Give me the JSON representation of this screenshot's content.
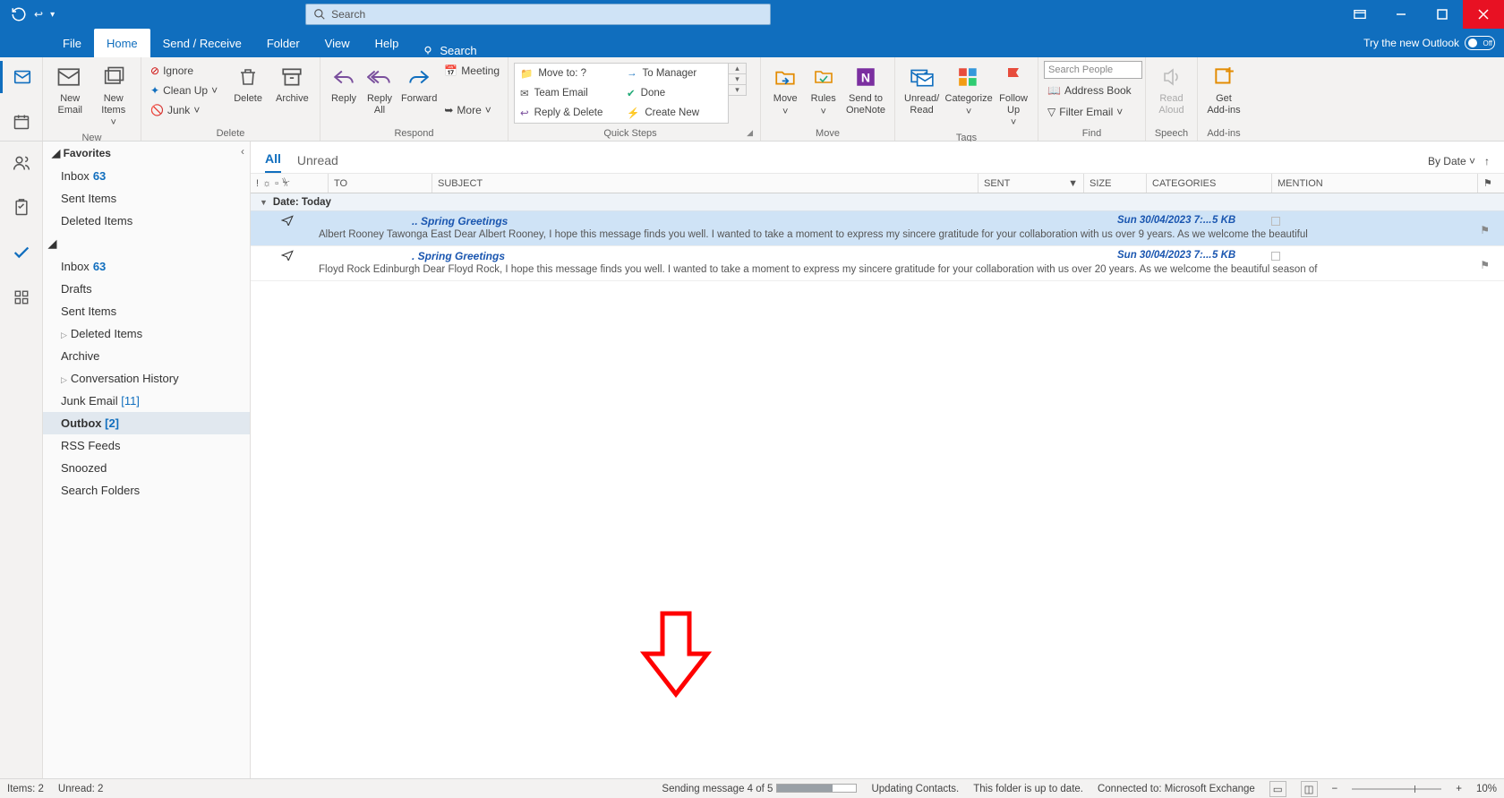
{
  "search_placeholder": "Search",
  "tabs": {
    "file": "File",
    "home": "Home",
    "sendreceive": "Send / Receive",
    "folder": "Folder",
    "view": "View",
    "help": "Help",
    "tellme": "Search"
  },
  "try_new": "Try the new Outlook",
  "toggle_off": "Off",
  "ribbon": {
    "new": {
      "email": "New Email",
      "items": "New Items",
      "label": "New"
    },
    "delete": {
      "ignore": "Ignore",
      "cleanup": "Clean Up",
      "junk": "Junk",
      "delete": "Delete",
      "archive": "Archive",
      "label": "Delete"
    },
    "respond": {
      "reply": "Reply",
      "replyall": "Reply All",
      "forward": "Forward",
      "meeting": "Meeting",
      "more": "More",
      "label": "Respond"
    },
    "quicksteps": {
      "moveto": "Move to: ?",
      "tomanager": "To Manager",
      "teamemail": "Team Email",
      "done": "Done",
      "replydelete": "Reply & Delete",
      "createnew": "Create New",
      "label": "Quick Steps"
    },
    "move": {
      "move": "Move",
      "rules": "Rules",
      "onenote": "Send to OneNote",
      "label": "Move"
    },
    "tags": {
      "unread": "Unread/ Read",
      "categorize": "Categorize",
      "followup": "Follow Up",
      "label": "Tags"
    },
    "find": {
      "searchpeople": "Search People",
      "addressbook": "Address Book",
      "filter": "Filter Email",
      "label": "Find"
    },
    "speech": {
      "readaloud": "Read Aloud",
      "label": "Speech"
    },
    "addins": {
      "get": "Get Add-ins",
      "label": "Add-ins"
    }
  },
  "favorites": {
    "header": "Favorites",
    "items": [
      {
        "label": "Inbox",
        "count": "63"
      },
      {
        "label": "Sent Items"
      },
      {
        "label": "Deleted Items"
      }
    ]
  },
  "folders": [
    {
      "label": "Inbox",
      "count": "63"
    },
    {
      "label": "Drafts"
    },
    {
      "label": "Sent Items"
    },
    {
      "label": "Deleted Items",
      "expandable": true
    },
    {
      "label": "Archive"
    },
    {
      "label": "Conversation History",
      "expandable": true
    },
    {
      "label": "Junk Email",
      "bracket": "[11]"
    },
    {
      "label": "Outbox",
      "bracket": "[2]",
      "selected": true
    },
    {
      "label": "RSS Feeds"
    },
    {
      "label": "Snoozed"
    },
    {
      "label": "Search Folders"
    }
  ],
  "filters": {
    "all": "All",
    "unread": "Unread",
    "bydate": "By Date"
  },
  "columns": {
    "to": "TO",
    "subject": "SUBJECT",
    "sent": "SENT",
    "size": "SIZE",
    "categories": "CATEGORIES",
    "mention": "MENTION"
  },
  "group_today": "Date: Today",
  "messages": [
    {
      "subject": ".. Spring Greetings",
      "sent": "Sun 30/04/2023 7:...",
      "size": "5 KB",
      "preview": "Albert Rooney   Tawonga East   Dear Albert Rooney,   I hope this message finds you well. I wanted to take a moment to express my sincere gratitude for your collaboration with us over 9 years.   As we welcome the beautiful",
      "selected": true
    },
    {
      "subject": ". Spring Greetings",
      "sent": "Sun 30/04/2023 7:...",
      "size": "5 KB",
      "preview": "Floyd Rock   Edinburgh   Dear Floyd Rock,   I hope this message finds you well. I wanted to take a moment to express my sincere gratitude for your collaboration with us over 20 years.   As we welcome the beautiful season of"
    }
  ],
  "status": {
    "items": "Items: 2",
    "unread": "Unread: 2",
    "sending": "Sending message 4 of 5",
    "updating": "Updating Contacts.",
    "uptodate": "This folder is up to date.",
    "connected": "Connected to: Microsoft Exchange",
    "zoom": "10%"
  }
}
